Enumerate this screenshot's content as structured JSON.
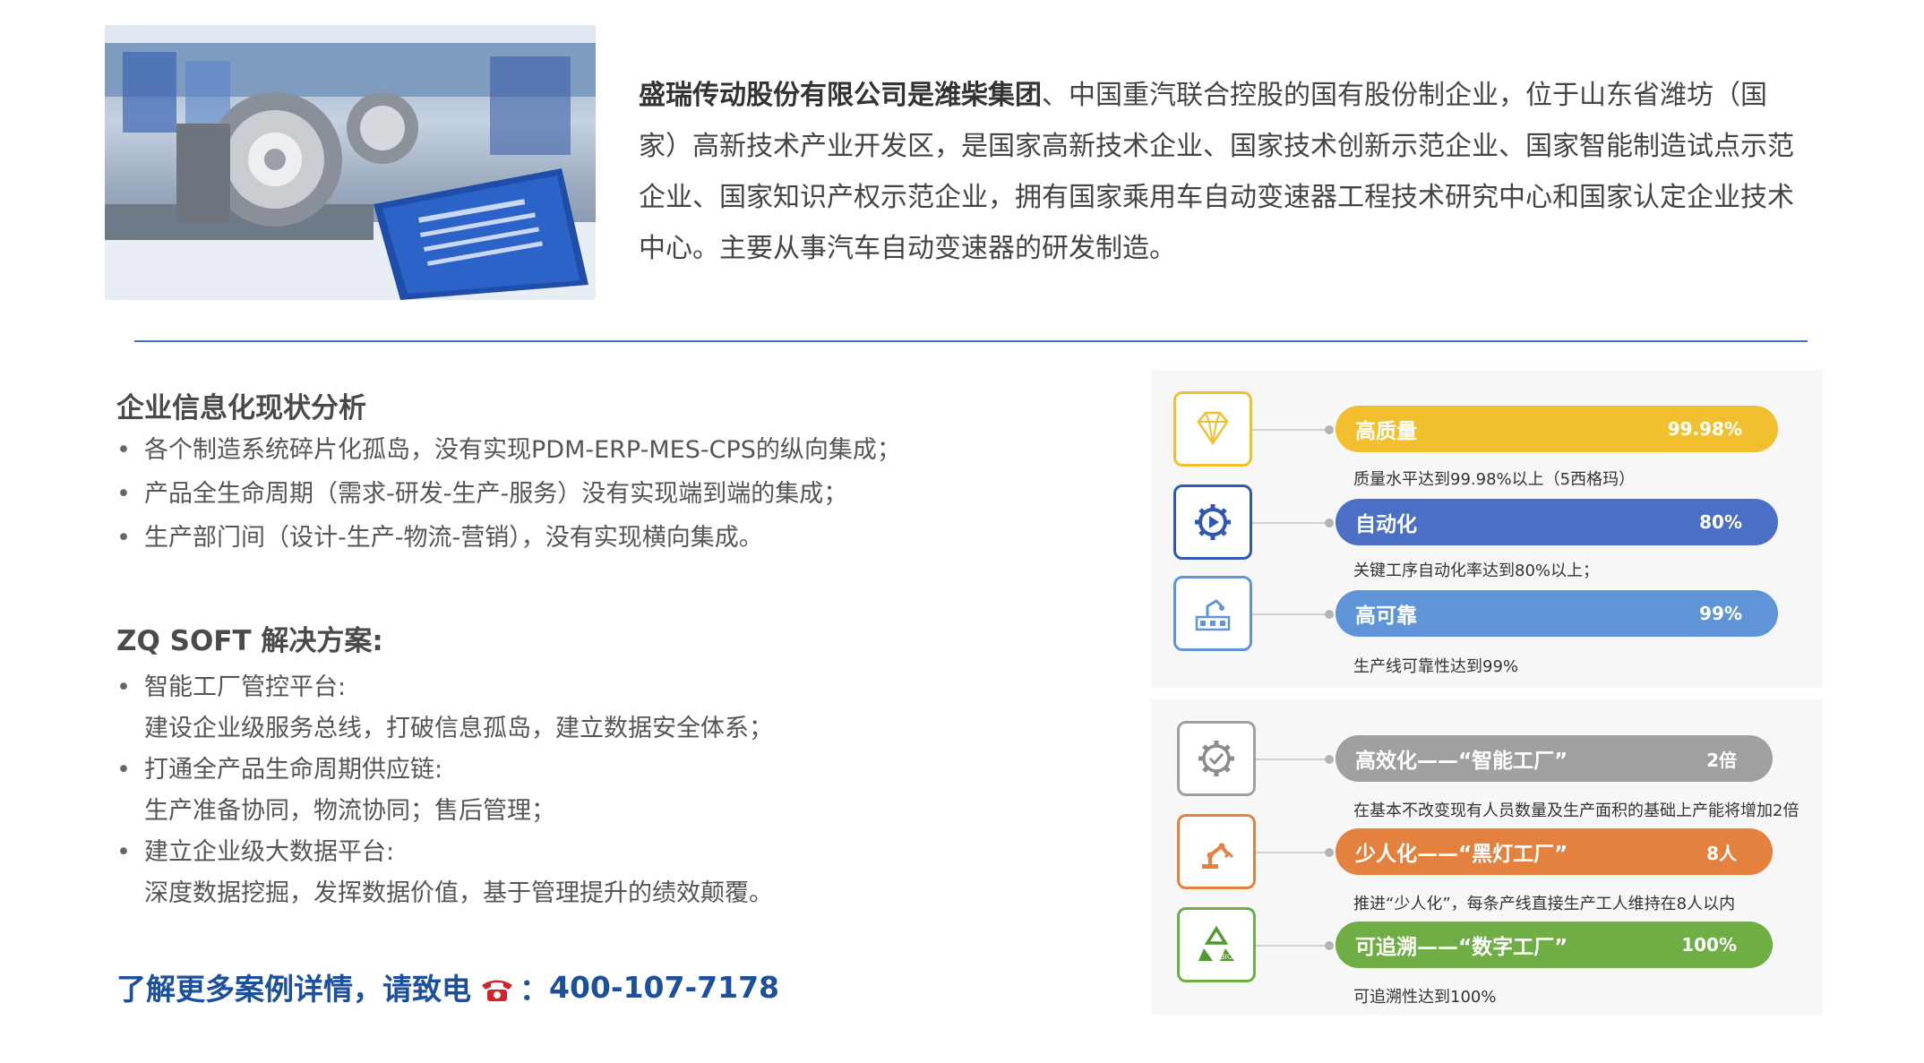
{
  "intro": {
    "lead": "盛瑞传动股份有限公司是潍柴集团",
    "body": "、中国重汽联合控股的国有股份制企业，位于山东省潍坊（国家）高新技术产业开发区，是国家高新技术企业、国家技术创新示范企业、国家智能制造试点示范企业、国家知识产权示范企业，拥有国家乘用车自动变速器工程技术研究中心和国家认定企业技术中心。主要从事汽车自动变速器的研发制造。"
  },
  "analysis": {
    "title": "企业信息化现状分析",
    "items": [
      "各个制造系统碎片化孤岛，没有实现PDM-ERP-MES-CPS的纵向集成；",
      "产品全生命周期（需求-研发-生产-服务）没有实现端到端的集成；",
      "生产部门间（设计-生产-物流-营销），没有实现横向集成。"
    ]
  },
  "solution": {
    "title": "ZQ SOFT 解决方案:",
    "items": [
      {
        "label": "智能工厂管控平台:",
        "sub": "建设企业级服务总线，打破信息孤岛，建立数据安全体系；"
      },
      {
        "label": "打通全产品生命周期供应链:",
        "sub": "生产准备协同，物流协同；售后管理；"
      },
      {
        "label": "建立企业级大数据平台:",
        "sub": "深度数据挖掘，发挥数据价值，基于管理提升的绩效颠覆。"
      }
    ]
  },
  "contact": {
    "text": "了解更多案例详情，请致电",
    "colon": "：",
    "phone": "400-107-7178"
  },
  "metrics_top": [
    {
      "label": "高质量",
      "value": "99.98%",
      "desc": "质量水平达到99.98%以上（5西格玛）",
      "color": "#f2c02f",
      "icon": "diamond-icon"
    },
    {
      "label": "自动化",
      "value": "80%",
      "desc": "关键工序自动化率达到80%以上；",
      "color": "#4a6fc4",
      "icon": "gear-play-icon"
    },
    {
      "label": "高可靠",
      "value": "99%",
      "desc": "生产线可靠性达到99%",
      "color": "#5f95d8",
      "icon": "factory-robot-icon"
    }
  ],
  "metrics_bottom": [
    {
      "label": "高效化——“智能工厂”",
      "value": "2倍",
      "desc": "在基本不改变现有人员数量及生产面积的基础上产能将增加2倍",
      "color": "#a0a0a0",
      "icon": "gear-check-icon"
    },
    {
      "label": "少人化——“黑灯工厂”",
      "value": "8人",
      "desc": "推进“少人化”，每条产线直接生产工人维持在8人以内",
      "color": "#e4813f",
      "icon": "robot-arm-icon"
    },
    {
      "label": "可追溯——“数字工厂”",
      "value": "100%",
      "desc": "可追溯性达到100%",
      "color": "#6fae45",
      "icon": "recycle-bio-icon"
    }
  ],
  "colors": {
    "accent_blue": "#1c4f9c",
    "divider": "#3c73c9"
  }
}
